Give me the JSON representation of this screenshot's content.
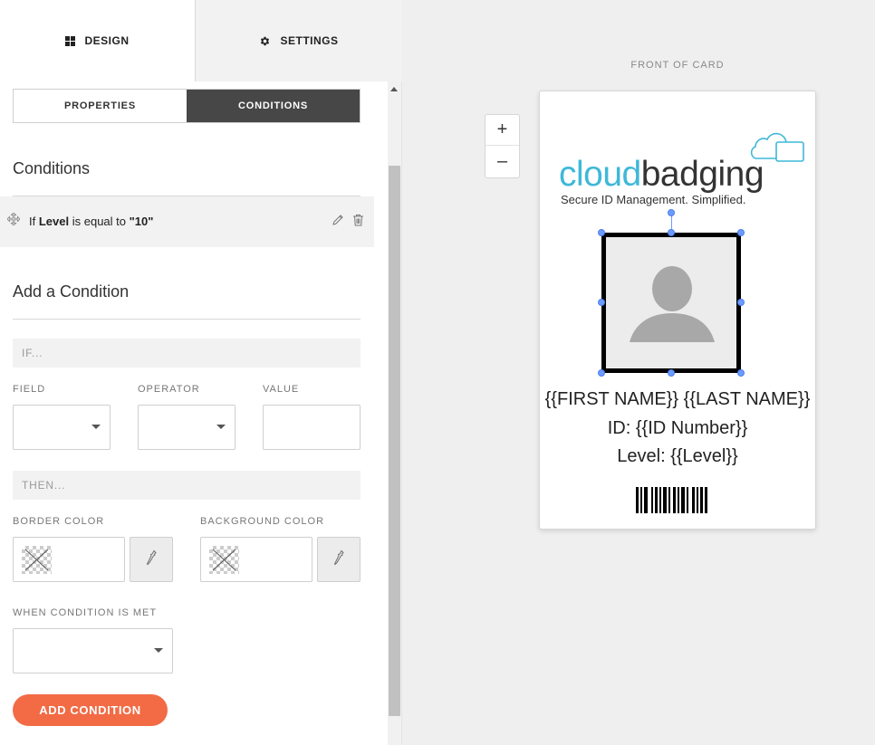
{
  "top_tabs": {
    "design": "DESIGN",
    "settings": "SETTINGS"
  },
  "sub_tabs": {
    "properties": "PROPERTIES",
    "conditions": "CONDITIONS"
  },
  "conditions_section": {
    "title": "Conditions",
    "items": [
      {
        "prefix": "If",
        "field": "Level",
        "operator": "is equal to",
        "value": "\"10\""
      }
    ]
  },
  "add_condition": {
    "title": "Add a Condition",
    "if_label": "IF...",
    "field_label": "FIELD",
    "operator_label": "OPERATOR",
    "value_label": "VALUE",
    "field_value": "",
    "operator_value": "",
    "value_value": "",
    "then_label": "THEN...",
    "border_color_label": "BORDER COLOR",
    "background_color_label": "BACKGROUND COLOR",
    "when_met_label": "WHEN CONDITION IS MET",
    "when_met_value": "",
    "submit_label": "ADD CONDITION"
  },
  "preview": {
    "title": "FRONT OF CARD",
    "zoom_in": "+",
    "zoom_out": "–"
  },
  "card": {
    "logo_part1": "cloud",
    "logo_part2": "badging",
    "tagline": "Secure ID Management. Simplified.",
    "name_line": "{{FIRST NAME}} {{LAST NAME}}",
    "id_line": "ID: {{ID Number}}",
    "level_line": "Level: {{Level}}"
  },
  "colors": {
    "accent": "#f26b45",
    "active_tab": "#474747",
    "logo_blue": "#3fb8d8",
    "selection_handle": "#6f9bff"
  },
  "icons": {
    "design": "grid-icon",
    "settings": "gear-icon",
    "drag": "move-icon",
    "edit": "pencil-icon",
    "delete": "trash-icon",
    "picker": "eyedropper-icon",
    "logo": "cloud-icon"
  }
}
